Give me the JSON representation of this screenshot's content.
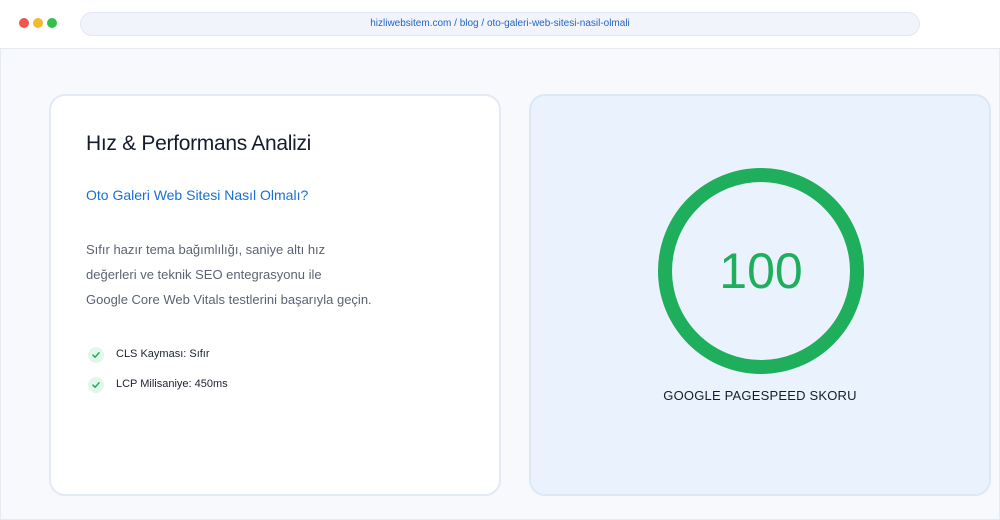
{
  "browser": {
    "url": "hizliwebsitem.com / blog / oto-galeri-web-sitesi-nasil-olmali"
  },
  "left_card": {
    "title": "Hız & Performans Analizi",
    "subtitle": "Oto Galeri Web Sitesi Nasıl Olmalı?",
    "description_lines": [
      "Sıfır hazır tema bağımlılığı, saniye altı hız",
      "değerleri ve teknik SEO entegrasyonu ile",
      "Google Core Web Vitals testlerini başarıyla geçin."
    ],
    "checklist": [
      {
        "label": "CLS Kayması: Sıfır",
        "icon": "check-icon"
      },
      {
        "label": "LCP Milisaniye: 450ms",
        "icon": "check-icon"
      }
    ]
  },
  "right_card": {
    "score": "100",
    "score_fraction": 1.0,
    "label": "GOOGLE PAGESPEED SKORU"
  },
  "colors": {
    "accent_green": "#1fae5b",
    "link_blue": "#1a6fd6",
    "panel_blue": "#eaf3fd"
  }
}
